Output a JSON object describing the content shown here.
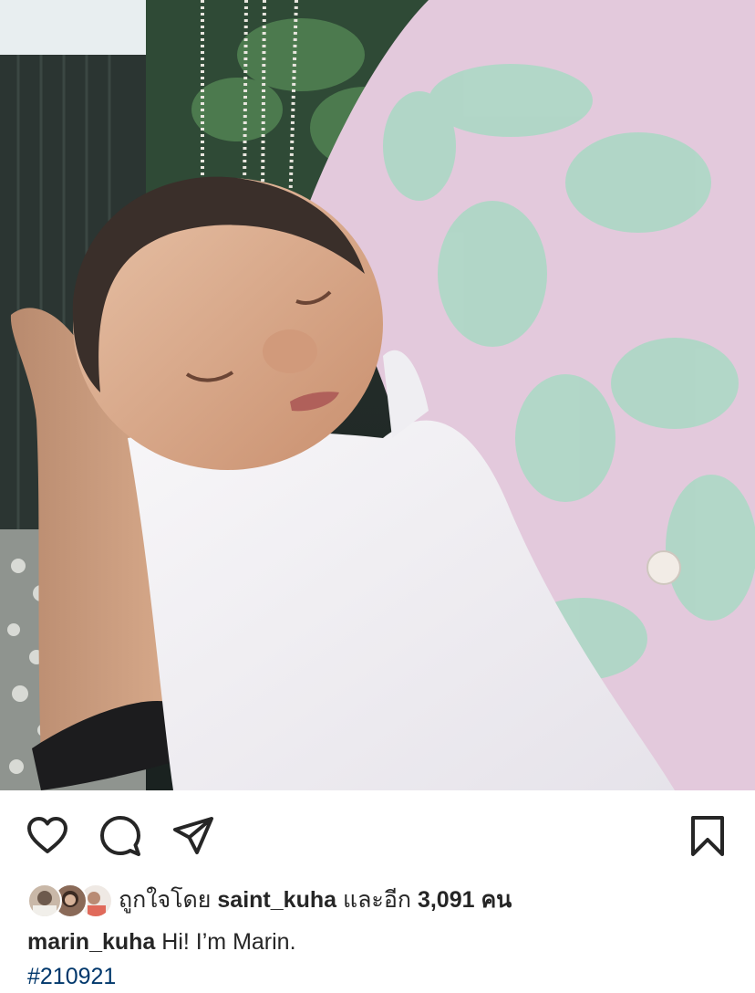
{
  "post": {
    "image_alt": "Newborn baby sleeping wrapped in a white blanket",
    "actions": {
      "like_icon": "heart-icon",
      "comment_icon": "comment-icon",
      "share_icon": "share-icon",
      "save_icon": "bookmark-icon"
    },
    "likes": {
      "prefix": "ถูกใจโดย",
      "liked_by_user": "saint_kuha",
      "conjunction": "และอีก",
      "count": "3,091",
      "suffix": "คน"
    },
    "caption": {
      "username": "marin_kuha",
      "text": "Hi! I’m Marin."
    },
    "hashtag": "#210921"
  },
  "colors": {
    "text": "#262626",
    "hashtag": "#00376b",
    "background": "#ffffff"
  }
}
